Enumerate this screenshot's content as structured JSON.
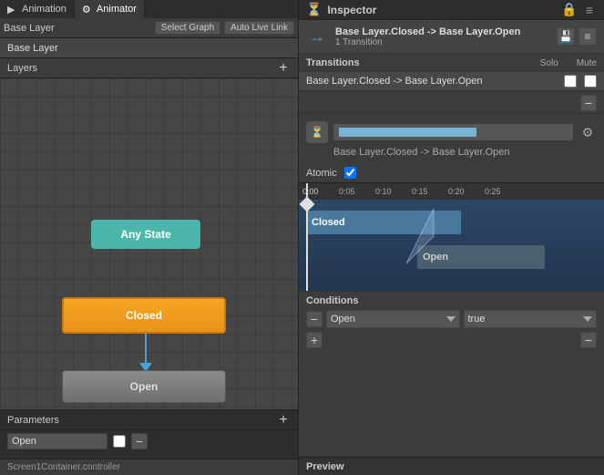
{
  "left": {
    "tabs": [
      {
        "label": "Animation",
        "icon": "▶",
        "active": false
      },
      {
        "label": "Animator",
        "icon": "⚙",
        "active": true
      }
    ],
    "toolbar": {
      "label": "Base Layer",
      "select_graph_btn": "Select Graph",
      "auto_live_link_btn": "Auto Live Link"
    },
    "breadcrumb": "Base Layer",
    "layers": {
      "title": "Layers",
      "add_label": "+"
    },
    "states": {
      "any_state": "Any State",
      "closed": "Closed",
      "open": "Open"
    },
    "parameters": {
      "title": "Parameters",
      "add_label": "+",
      "items": [
        {
          "name": "Open",
          "checked": false
        }
      ]
    },
    "status_bar": "Screen1Container.controller"
  },
  "right": {
    "inspector_title": "Inspector",
    "transition_title": "Base Layer.Closed -> Base Layer.Open",
    "transition_sub": "1 Transition",
    "transitions_section": "Transitions",
    "solo_label": "Solo",
    "mute_label": "Mute",
    "transition_row_text": "Base Layer.Closed -> Base Layer.Open",
    "atomic_label": "Atomic",
    "timeline": {
      "marks": [
        "0:00",
        "0:05",
        "0:10",
        "0:15",
        "0:20",
        "0:25"
      ],
      "track_closed": "Closed",
      "track_open": "Open"
    },
    "conditions": {
      "title": "Conditions",
      "param": "Open",
      "value": "true"
    },
    "preview_label": "Preview"
  }
}
